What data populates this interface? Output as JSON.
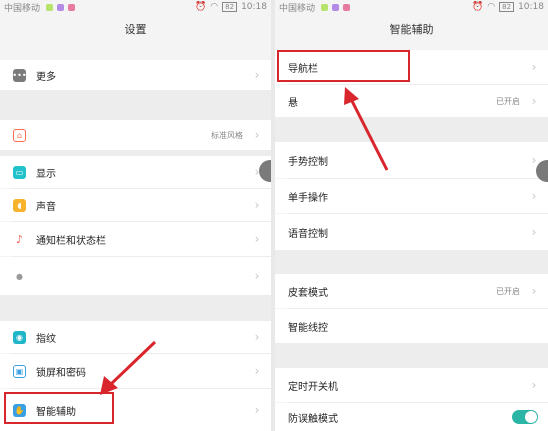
{
  "status_bar": {
    "carrier": "中国移动",
    "time": "10:18",
    "battery": "82"
  },
  "left": {
    "title": "设置",
    "items": [
      {
        "label": "更多",
        "value": "",
        "icon": "more-icon",
        "color": "#7b7b7b"
      },
      {
        "label": "",
        "value": "标准风格",
        "icon": "home-icon",
        "color": "#ff6b4d"
      },
      {
        "label": "显示",
        "value": "",
        "icon": "display-icon",
        "color": "#21c2c9"
      },
      {
        "label": "声音",
        "value": "",
        "icon": "sound-icon",
        "color": "#f7b32b"
      },
      {
        "label": "通知栏和状态栏",
        "value": "",
        "icon": "notification-icon",
        "color": "#f05a4a"
      },
      {
        "label": "",
        "value": "",
        "icon": "partial-icon",
        "color": "#9a9a9a"
      },
      {
        "label": "指纹",
        "value": "",
        "icon": "fingerprint-icon",
        "color": "#21b5c9"
      },
      {
        "label": "锁屏和密码",
        "value": "",
        "icon": "lock-icon",
        "color": "#3aa0e6"
      },
      {
        "label": "智能辅助",
        "value": "",
        "icon": "smart-assist-icon",
        "color": "#3aa0e6"
      }
    ]
  },
  "right": {
    "title": "智能辅助",
    "items": [
      {
        "label": "导航栏",
        "value": ""
      },
      {
        "label": "悬",
        "value": "已开启"
      },
      {
        "label": "手势控制",
        "value": ""
      },
      {
        "label": "单手操作",
        "value": ""
      },
      {
        "label": "语音控制",
        "value": ""
      },
      {
        "label": "皮套模式",
        "value": "已开启"
      },
      {
        "label": "智能线控",
        "value": ""
      },
      {
        "label": "定时开关机",
        "value": ""
      },
      {
        "label": "防误触模式",
        "value": ""
      }
    ]
  },
  "colors": {
    "highlight": "#d8262c",
    "toggle_on": "#2bb5a6"
  }
}
